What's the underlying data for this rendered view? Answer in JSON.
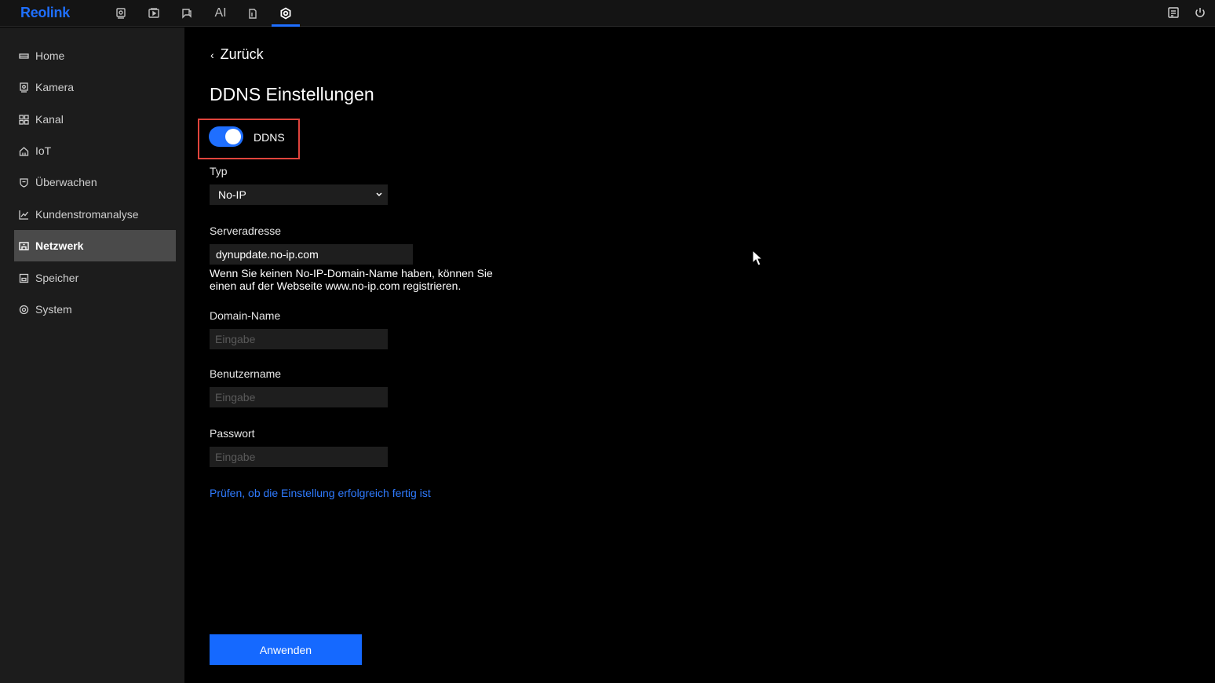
{
  "brand": {
    "name": "Reolink",
    "color": "#1f6fff"
  },
  "topnav": {
    "icons": [
      "live-view-icon",
      "playback-icon",
      "messages-icon",
      "ai-label",
      "files-icon",
      "settings-icon"
    ],
    "ai_label": "AI",
    "active": "settings-icon"
  },
  "topright": {
    "icons": [
      "notes-icon",
      "power-icon"
    ]
  },
  "sidebar": {
    "items": [
      {
        "label": "Home",
        "icon": "home-icon"
      },
      {
        "label": "Kamera",
        "icon": "camera-icon"
      },
      {
        "label": "Kanal",
        "icon": "grid-icon"
      },
      {
        "label": "IoT",
        "icon": "house-icon"
      },
      {
        "label": "Überwachen",
        "icon": "shield-icon"
      },
      {
        "label": "Kundenstromanalyse",
        "icon": "chart-icon"
      },
      {
        "label": "Netzwerk",
        "icon": "network-icon",
        "active": true
      },
      {
        "label": "Speicher",
        "icon": "storage-icon"
      },
      {
        "label": "System",
        "icon": "gear-icon"
      }
    ]
  },
  "page": {
    "back_label": "Zurück",
    "title": "DDNS Einstellungen",
    "ddns_toggle_label": "DDNS",
    "ddns_enabled": true,
    "type_label": "Typ",
    "type_value": "No-IP",
    "server_label": "Serveradresse",
    "server_value": "dynupdate.no-ip.com",
    "hint_line1": "Wenn Sie keinen No-IP-Domain-Name haben, können Sie",
    "hint_line2": "einen auf der Webseite www.no-ip.com registrieren.",
    "domain_label": "Domain-Name",
    "domain_placeholder": "Eingabe",
    "user_label": "Benutzername",
    "user_placeholder": "Eingabe",
    "password_label": "Passwort",
    "password_placeholder": "Eingabe",
    "check_link": "Prüfen, ob die Einstellung erfolgreich fertig ist",
    "apply_label": "Anwenden"
  },
  "colors": {
    "accent": "#1f6fff",
    "highlight": "#e0443c",
    "link": "#2f7bff"
  }
}
